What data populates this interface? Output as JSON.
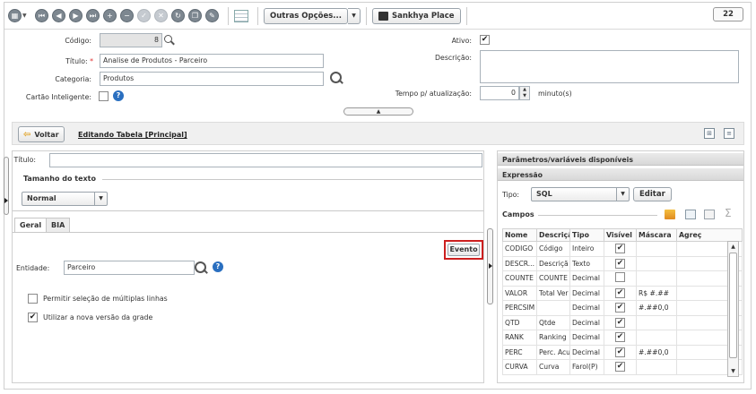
{
  "toolbar": {
    "more_options": "Outras Opções...",
    "sankhya_place": "Sankhya Place",
    "count": "22"
  },
  "form": {
    "codigo_label": "Código:",
    "codigo_value": "8",
    "titulo_label": "Título:",
    "titulo_value": "Analise de Produtos - Parceiro",
    "categoria_label": "Categoria:",
    "categoria_value": "Produtos",
    "cartao_label": "Cartão Inteligente:",
    "ativo_label": "Ativo:",
    "ativo_checked": "✔",
    "descricao_label": "Descrição:",
    "descricao_value": "",
    "tempo_label": "Tempo p/ atualização:",
    "tempo_value": "0",
    "tempo_unit": "minuto(s)"
  },
  "editbar": {
    "voltar": "Voltar",
    "title": "Editando Tabela [Principal]"
  },
  "left": {
    "titulo_label": "Título:",
    "titulo_value": "",
    "tamanho_label": "Tamanho do texto",
    "tamanho_value": "Normal",
    "tabs": [
      "Geral",
      "BIA"
    ],
    "evento": "Evento",
    "entidade_label": "Entidade:",
    "entidade_value": "Parceiro",
    "opt1": "Permitir seleção de múltiplas linhas",
    "opt1_checked": "",
    "opt2": "Utilizar a nova versão da grade",
    "opt2_checked": "✔"
  },
  "right": {
    "header": "Parâmetros/variáveis disponíveis",
    "expressao": "Expressão",
    "tipo_label": "Tipo:",
    "tipo_value": "SQL",
    "editar": "Editar",
    "campos": "Campos",
    "columns": [
      "Nome",
      "Descriçã",
      "Tipo",
      "Visível",
      "Máscara",
      "Agreç"
    ],
    "rows": [
      {
        "nome": "CODIGO",
        "desc": "Código",
        "tipo": "Inteiro",
        "vis": "✔",
        "masc": ""
      },
      {
        "nome": "DESCR...",
        "desc": "Descriçã",
        "tipo": "Texto",
        "vis": "✔",
        "masc": ""
      },
      {
        "nome": "COUNTE",
        "desc": "COUNTE",
        "tipo": "Decimal",
        "vis": "",
        "masc": ""
      },
      {
        "nome": "VALOR",
        "desc": "Total Ver",
        "tipo": "Decimal",
        "vis": "✔",
        "masc": "R$ #.##"
      },
      {
        "nome": "PERCSIM",
        "desc": "",
        "tipo": "Decimal",
        "vis": "✔",
        "masc": "#.##0,0"
      },
      {
        "nome": "QTD",
        "desc": "Qtde",
        "tipo": "Decimal",
        "vis": "✔",
        "masc": ""
      },
      {
        "nome": "RANK",
        "desc": "Ranking",
        "tipo": "Decimal",
        "vis": "✔",
        "masc": ""
      },
      {
        "nome": "PERC",
        "desc": "Perc. Acu",
        "tipo": "Decimal",
        "vis": "✔",
        "masc": "#.##0,0"
      },
      {
        "nome": "CURVA",
        "desc": "Curva",
        "tipo": "Farol(P)",
        "vis": "✔",
        "masc": ""
      }
    ]
  }
}
